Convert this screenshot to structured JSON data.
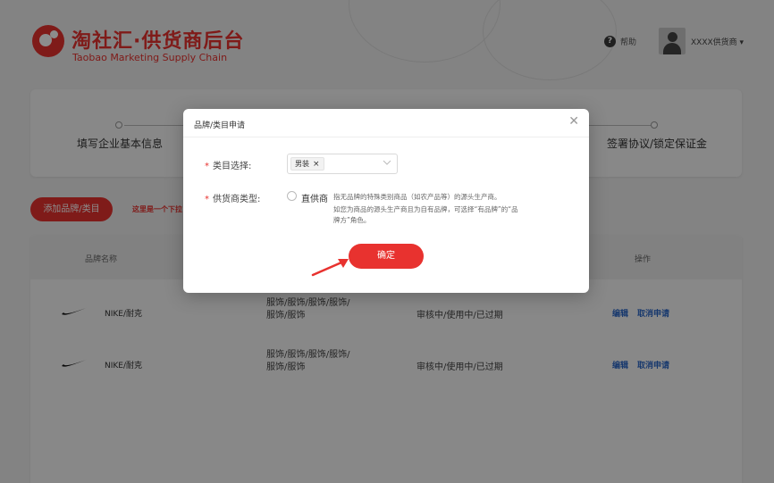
{
  "brand": {
    "title_cn": "淘社汇·供货商后台",
    "title_en": "Taobao Marketing Supply Chain",
    "icon": "taosehui-logo-icon",
    "color": "#e8322f"
  },
  "header": {
    "help_label": "帮助",
    "help_icon": "question-circle-icon",
    "user_name": "XXXX供货商 ▾"
  },
  "steps": [
    {
      "label": "填写企业基本信息"
    },
    {
      "label": "签署协议/锁定保证金"
    }
  ],
  "actions": {
    "add_brand_label": "添加品牌/类目",
    "hint": "这里是一个下拉"
  },
  "table": {
    "columns": [
      "品牌名称",
      "操作"
    ],
    "rows": [
      {
        "brand": "NIKE/耐克",
        "category_line1": "服饰/服饰/服饰/服饰/",
        "category_line2": "服饰/服饰",
        "status": "审核中/使用中/已过期",
        "edit": "编辑",
        "cancel": "取消申请"
      },
      {
        "brand": "NIKE/耐克",
        "category_line1": "服饰/服饰/服饰/服饰/",
        "category_line2": "服饰/服饰",
        "status": "审核中/使用中/已过期",
        "edit": "编辑",
        "cancel": "取消申请"
      }
    ]
  },
  "modal": {
    "title": "品牌/类目申请",
    "close_icon": "close-icon",
    "category_label": "类目选择:",
    "category_selected": "男装",
    "supplier_type_label": "供货商类型:",
    "radio_option": "直供商",
    "desc_line1": "指无品牌的特殊类别商品（如农产品等）的源头生产商。",
    "desc_line2": "如您为商品的源头生产商且为自有品牌，可选择“有品牌”的“品",
    "desc_line3": "牌方”角色。",
    "confirm_label": "确定"
  },
  "colors": {
    "accent": "#e8322f",
    "link": "#2d68c8"
  }
}
